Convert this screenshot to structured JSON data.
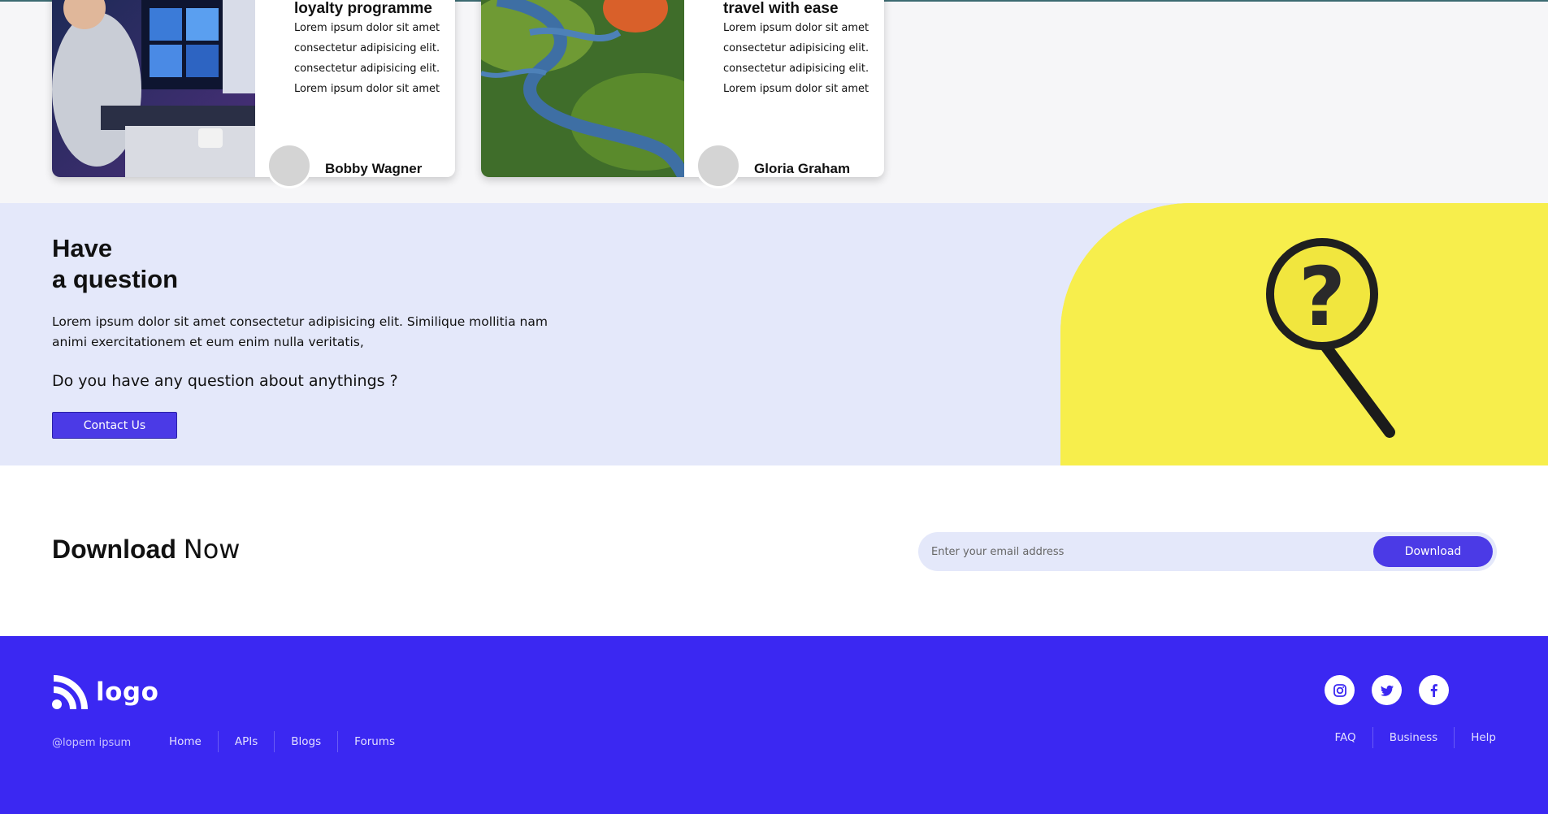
{
  "cards": [
    {
      "title": "loyalty programme",
      "lines": [
        "Lorem ipsum dolor sit amet",
        "consectetur adipisicing elit.",
        "consectetur adipisicing elit.",
        "Lorem ipsum dolor sit amet"
      ],
      "author": "Bobby Wagner"
    },
    {
      "title": "travel with ease",
      "lines": [
        "Lorem ipsum dolor sit amet",
        "consectetur adipisicing elit.",
        "consectetur adipisicing elit.",
        "Lorem ipsum dolor sit amet"
      ],
      "author": "Gloria Graham"
    }
  ],
  "question": {
    "title_line1": "Have",
    "title_line2": "a question",
    "text": "Lorem ipsum dolor sit amet consectetur adipisicing elit. Similique mollitia nam animi exercitationem et eum enim nulla veritatis,",
    "ask": "Do you have any question about anythings ?",
    "button": "Contact Us"
  },
  "download": {
    "title_strong": "Download",
    "title_light": "Now",
    "placeholder": "Enter your email address",
    "button": "Download"
  },
  "footer": {
    "logo_text": "logo",
    "copyright": "@lopem ipsum",
    "nav": [
      "Home",
      "APIs",
      "Blogs",
      "Forums"
    ],
    "nav_right": [
      "FAQ",
      "Business",
      "Help"
    ],
    "social": [
      "instagram-icon",
      "twitter-icon",
      "facebook-icon"
    ]
  },
  "colors": {
    "accent": "#4b3ae6",
    "footer_bg": "#3b28f2",
    "question_bg": "#e4e8fa",
    "yellow": "#f7ee4c"
  }
}
